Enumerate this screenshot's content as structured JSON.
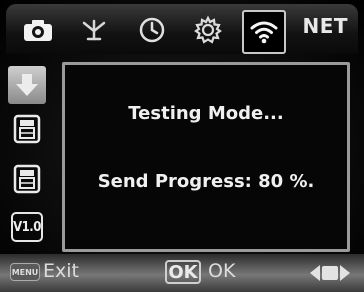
{
  "topbar": {
    "tabs": [
      {
        "icon": "camera-icon"
      },
      {
        "icon": "antenna-icon"
      },
      {
        "icon": "clock-icon"
      },
      {
        "icon": "gear-icon"
      },
      {
        "icon": "wifi-icon",
        "active": true
      }
    ],
    "net_label": "NET"
  },
  "sidebar": {
    "items": [
      {
        "icon": "arrow-down-icon",
        "selected": true
      },
      {
        "icon": "sim-card-icon"
      },
      {
        "icon": "sim-card-icon"
      },
      {
        "icon": "version-icon",
        "label": "V1.0"
      }
    ]
  },
  "dialog": {
    "title": "Testing Mode...",
    "progress_text": "Send Progress: 80 %."
  },
  "bottombar": {
    "menu_label": "MENU",
    "exit_label": "Exit",
    "ok_button": "OK",
    "ok_label": "OK"
  }
}
